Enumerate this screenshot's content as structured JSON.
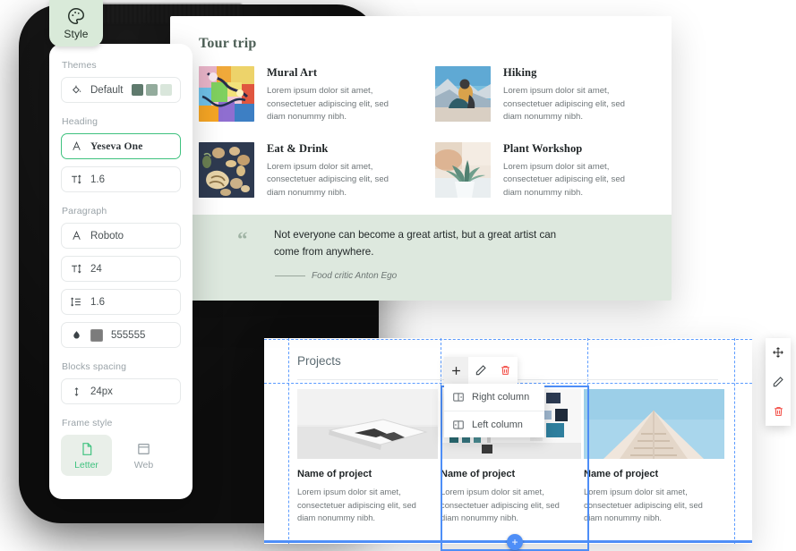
{
  "style_tab": {
    "label": "Style",
    "icon": "palette-icon"
  },
  "style_panel": {
    "groups": {
      "themes_label": "Themes",
      "heading_label": "Heading",
      "paragraph_label": "Paragraph",
      "blocks_spacing_label": "Blocks spacing",
      "frame_style_label": "Frame style"
    },
    "theme": {
      "name": "Default",
      "icon": "paint-bucket-icon",
      "swatches": [
        "#5f7a6d",
        "#93ab9c",
        "#d9e6db"
      ]
    },
    "heading_font": {
      "icon": "font-letter-icon",
      "value": "Yeseva One"
    },
    "heading_size": {
      "icon": "font-size-icon",
      "value": "1.6"
    },
    "paragraph_font": {
      "icon": "font-letter-icon",
      "value": "Roboto"
    },
    "paragraph_size": {
      "icon": "font-size-icon",
      "value": "24"
    },
    "paragraph_line_height": {
      "icon": "line-height-icon",
      "value": "1.6"
    },
    "paragraph_color": {
      "icon": "ink-drop-icon",
      "value": "555555",
      "swatch": "#7c7c7c"
    },
    "blocks_spacing": {
      "icon": "vertical-arrows-icon",
      "value": "24px"
    },
    "frame_letter": {
      "icon": "page-icon",
      "label": "Letter",
      "selected": true
    },
    "frame_web": {
      "icon": "browser-window-icon",
      "label": "Web",
      "selected": false
    },
    "accent_green": "#3fc27f"
  },
  "tour_doc": {
    "title": "Tour trip",
    "items": [
      {
        "heading": "Mural Art",
        "body": "Lorem ipsum dolor sit amet, consectetuer adipiscing elit, sed diam nonummy nibh.",
        "image": "mural-art-thumbnail"
      },
      {
        "heading": "Hiking",
        "body": "Lorem ipsum dolor sit amet, consectetuer adipiscing elit, sed diam nonummy nibh.",
        "image": "hiking-thumbnail"
      },
      {
        "heading": "Eat & Drink",
        "body": "Lorem ipsum dolor sit amet, consectetuer adipiscing elit, sed diam nonummy nibh.",
        "image": "eat-and-drink-thumbnail"
      },
      {
        "heading": "Plant Workshop",
        "body": "Lorem ipsum dolor sit amet, consectetuer adipiscing elit, sed diam nonummy nibh.",
        "image": "plant-workshop-thumbnail"
      }
    ],
    "quote": {
      "mark": "“",
      "text": "Not everyone can become a great artist, but a great artist can come from anywhere.",
      "attribution": "Food critic Anton Ego",
      "band_color": "#dde8de"
    },
    "title_color": "#4d5f56"
  },
  "projects_doc": {
    "title": "Projects",
    "cards": [
      {
        "name": "Name of project",
        "body": "Lorem ipsum dolor sit amet, consectetuer adipiscing elit, sed diam nonummy nibh.",
        "image": "laptop-mockup-thumbnail"
      },
      {
        "name": "Name of project",
        "body": "Lorem ipsum dolor sit amet, consectetuer adipiscing elit, sed diam nonummy nibh.",
        "image": "gallery-wall-thumbnail"
      },
      {
        "name": "Name of project",
        "body": "Lorem ipsum dolor sit amet, consectetuer adipiscing elit, sed diam nonummy nibh.",
        "image": "architecture-sky-thumbnail"
      }
    ],
    "selection_color": "#4e8ef7",
    "guide_color": "#5b9bff"
  },
  "context_toolbar": {
    "add": {
      "icon": "plus-icon",
      "label": "+"
    },
    "edit": {
      "icon": "pencil-icon"
    },
    "delete": {
      "icon": "trash-icon"
    }
  },
  "context_menu": {
    "items": [
      {
        "label": "Right column",
        "icon": "right-column-icon"
      },
      {
        "label": "Left column",
        "icon": "left-column-icon"
      }
    ]
  },
  "float_toolbar": {
    "items": [
      {
        "icon": "move-icon"
      },
      {
        "icon": "pencil-icon"
      },
      {
        "icon": "trash-icon"
      }
    ]
  },
  "add_block_handle": {
    "icon": "plus-icon",
    "label": "+"
  }
}
